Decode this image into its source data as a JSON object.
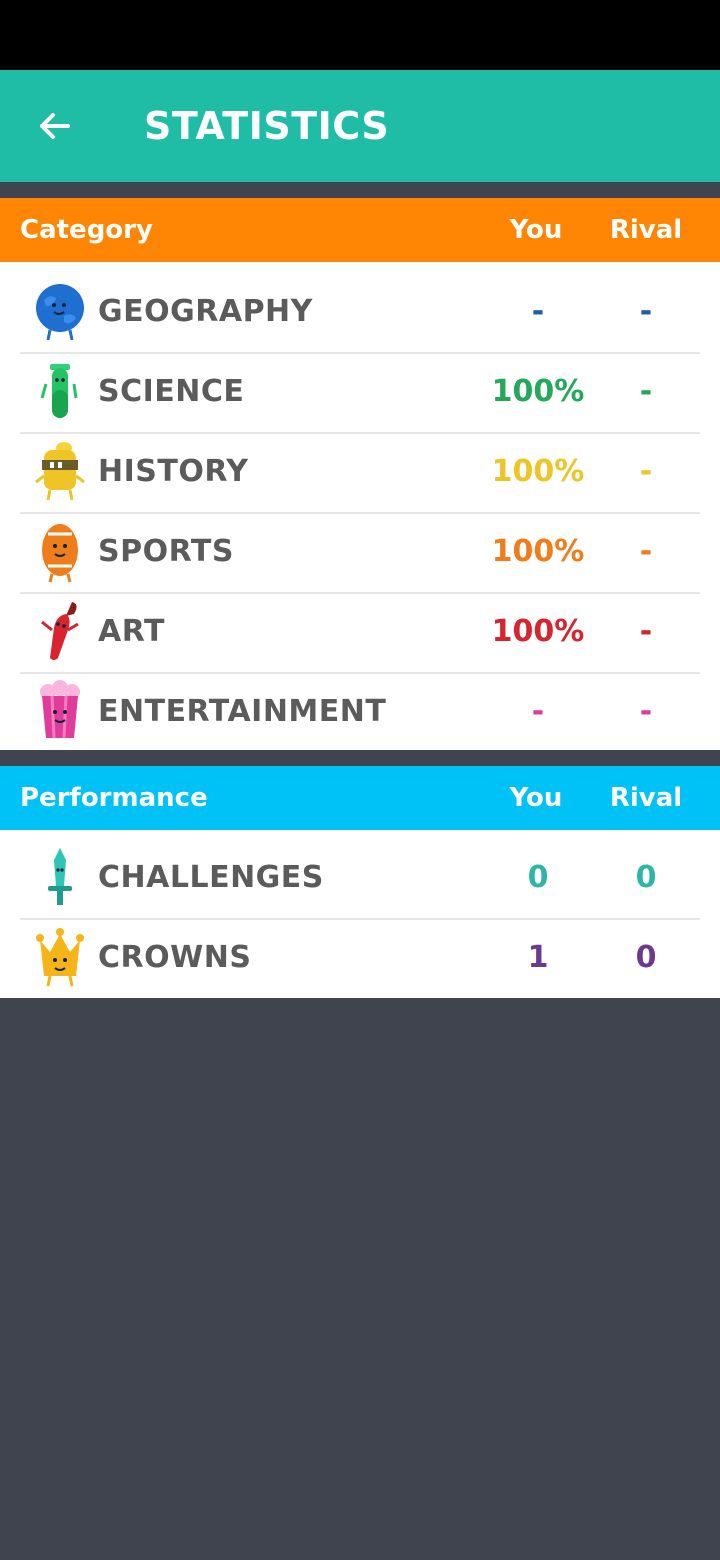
{
  "app_bar": {
    "title": "STATISTICS",
    "back_icon": "arrow-left-icon"
  },
  "category_section": {
    "header": {
      "label": "Category",
      "you": "You",
      "rival": "Rival",
      "color": "#ff8605"
    },
    "rows": [
      {
        "name": "GEOGRAPHY",
        "you": "-",
        "rival": "-",
        "color": "#1e5fa8",
        "icon": "globe-character-icon"
      },
      {
        "name": "SCIENCE",
        "you": "100%",
        "rival": "-",
        "color": "#24a95a",
        "icon": "test-tube-character-icon"
      },
      {
        "name": "HISTORY",
        "you": "100%",
        "rival": "-",
        "color": "#efc426",
        "icon": "knight-helmet-character-icon"
      },
      {
        "name": "SPORTS",
        "you": "100%",
        "rival": "-",
        "color": "#ee7d1b",
        "icon": "football-character-icon"
      },
      {
        "name": "ART",
        "you": "100%",
        "rival": "-",
        "color": "#d8242f",
        "icon": "paintbrush-character-icon"
      },
      {
        "name": "ENTERTAINMENT",
        "you": "-",
        "rival": "-",
        "color": "#e03c9a",
        "icon": "popcorn-character-icon"
      }
    ]
  },
  "performance_section": {
    "header": {
      "label": "Performance",
      "you": "You",
      "rival": "Rival",
      "color": "#00c2f6"
    },
    "rows": [
      {
        "name": "CHALLENGES",
        "you": "0",
        "rival": "0",
        "color": "#2db6a8",
        "icon": "sword-character-icon"
      },
      {
        "name": "CROWNS",
        "you": "1",
        "rival": "0",
        "color": "#6b3a8c",
        "icon": "crown-character-icon"
      }
    ]
  }
}
